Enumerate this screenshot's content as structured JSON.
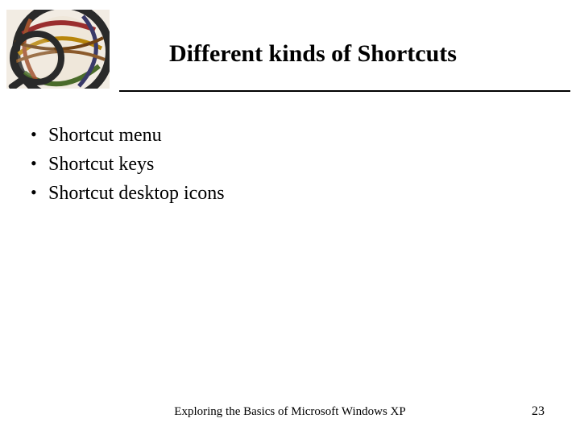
{
  "title": "Different kinds of Shortcuts",
  "bullets": [
    "Shortcut menu",
    "Shortcut keys",
    "Shortcut desktop icons"
  ],
  "footer": "Exploring the Basics of Microsoft Windows XP",
  "page_number": "23"
}
